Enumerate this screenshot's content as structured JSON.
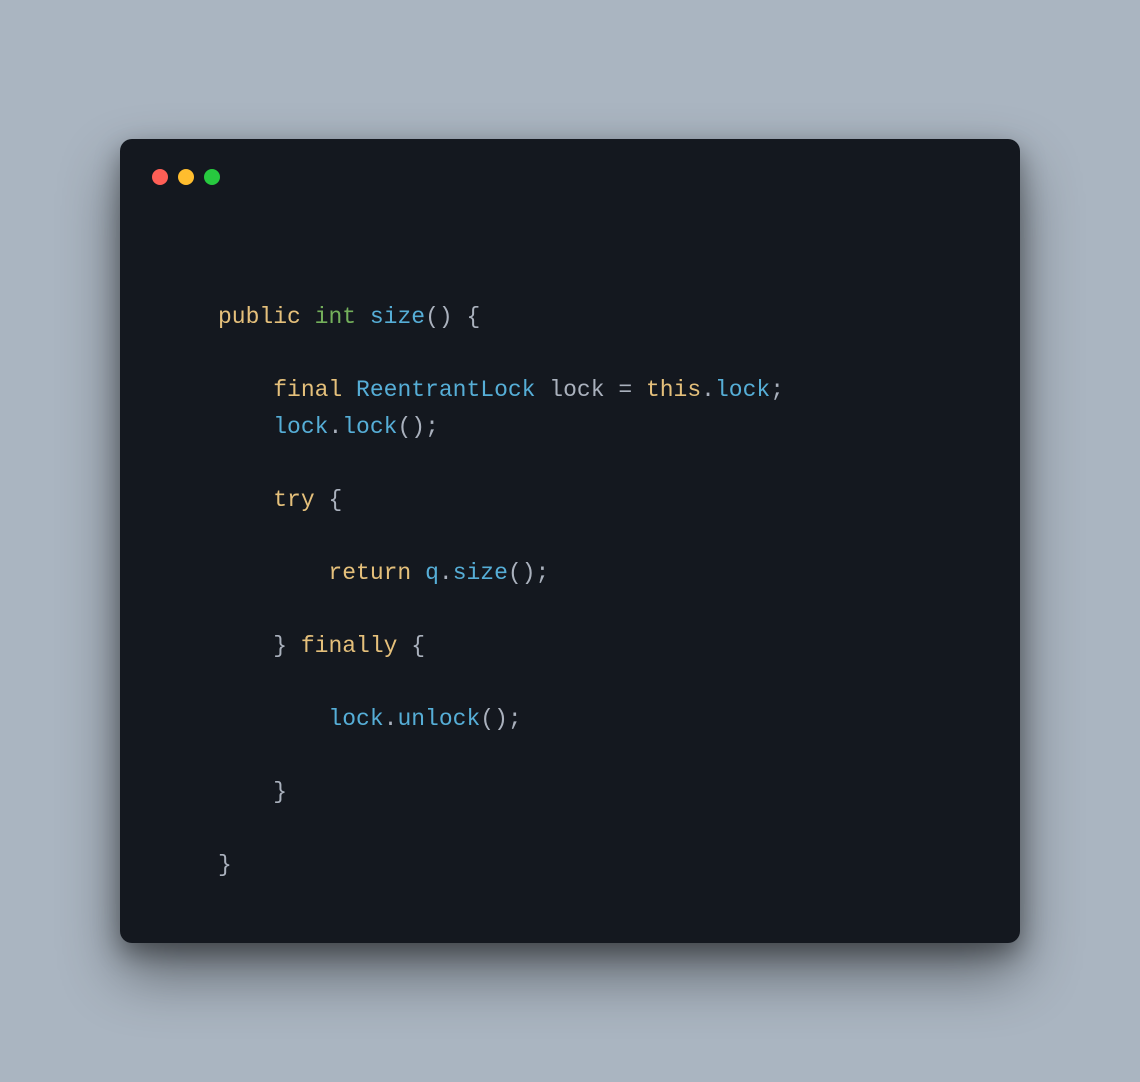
{
  "traffic": {
    "red": "#ff5f56",
    "yellow": "#ffbd2e",
    "green": "#27c93f"
  },
  "tok": {
    "public": "public",
    "int": "int",
    "size": "size",
    "final": "final",
    "ReentrantLock": "ReentrantLock",
    "lock_var": "lock",
    "eq": "=",
    "this": "this",
    "lock_field": "lock",
    "lock_call": "lock",
    "try": "try",
    "return": "return",
    "q": "q",
    "size2": "size",
    "finally": "finally",
    "unlock": "unlock",
    "lp": "(",
    "rp": ")",
    "lb": "{",
    "rb": "}",
    "semi": ";",
    "dot": "."
  }
}
